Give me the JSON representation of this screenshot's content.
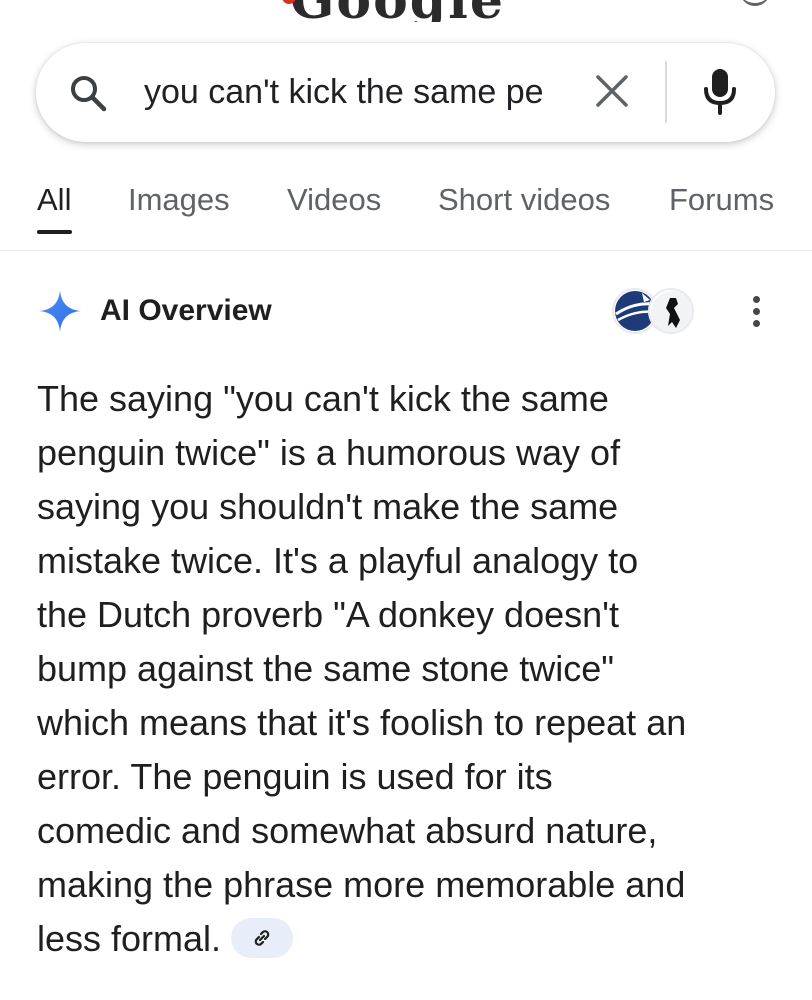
{
  "doodle": {
    "text": "Google"
  },
  "search": {
    "query": "you can't kick the same pe",
    "icons": {
      "search": "search-icon",
      "clear": "close-icon",
      "voice": "microphone-icon"
    }
  },
  "tabs": [
    {
      "label": "All",
      "active": true
    },
    {
      "label": "Images",
      "active": false
    },
    {
      "label": "Videos",
      "active": false
    },
    {
      "label": "Short videos",
      "active": false
    },
    {
      "label": "Forums",
      "active": false
    }
  ],
  "ai_overview": {
    "title": "AI Overview",
    "icons": {
      "sparkle": "sparkle-icon",
      "more": "more-vert-icon",
      "link": "link-icon"
    },
    "lines": [
      "The saying \"you can't kick the same",
      "penguin twice\" is a humorous way of",
      "saying you shouldn't make the same",
      "mistake twice. It's a playful analogy to",
      "the Dutch proverb \"A donkey doesn't",
      "bump against the same stone twice\"",
      "which means that it's foolish to repeat an",
      "error. The penguin is used for its",
      "comedic and somewhat absurd nature,",
      "making the phrase more memorable and",
      "less formal."
    ]
  },
  "colors": {
    "accent_blue": "#4285f4",
    "text": "#1f1f1f",
    "muted": "#5f6368",
    "chip_bg": "#e8eef9"
  }
}
